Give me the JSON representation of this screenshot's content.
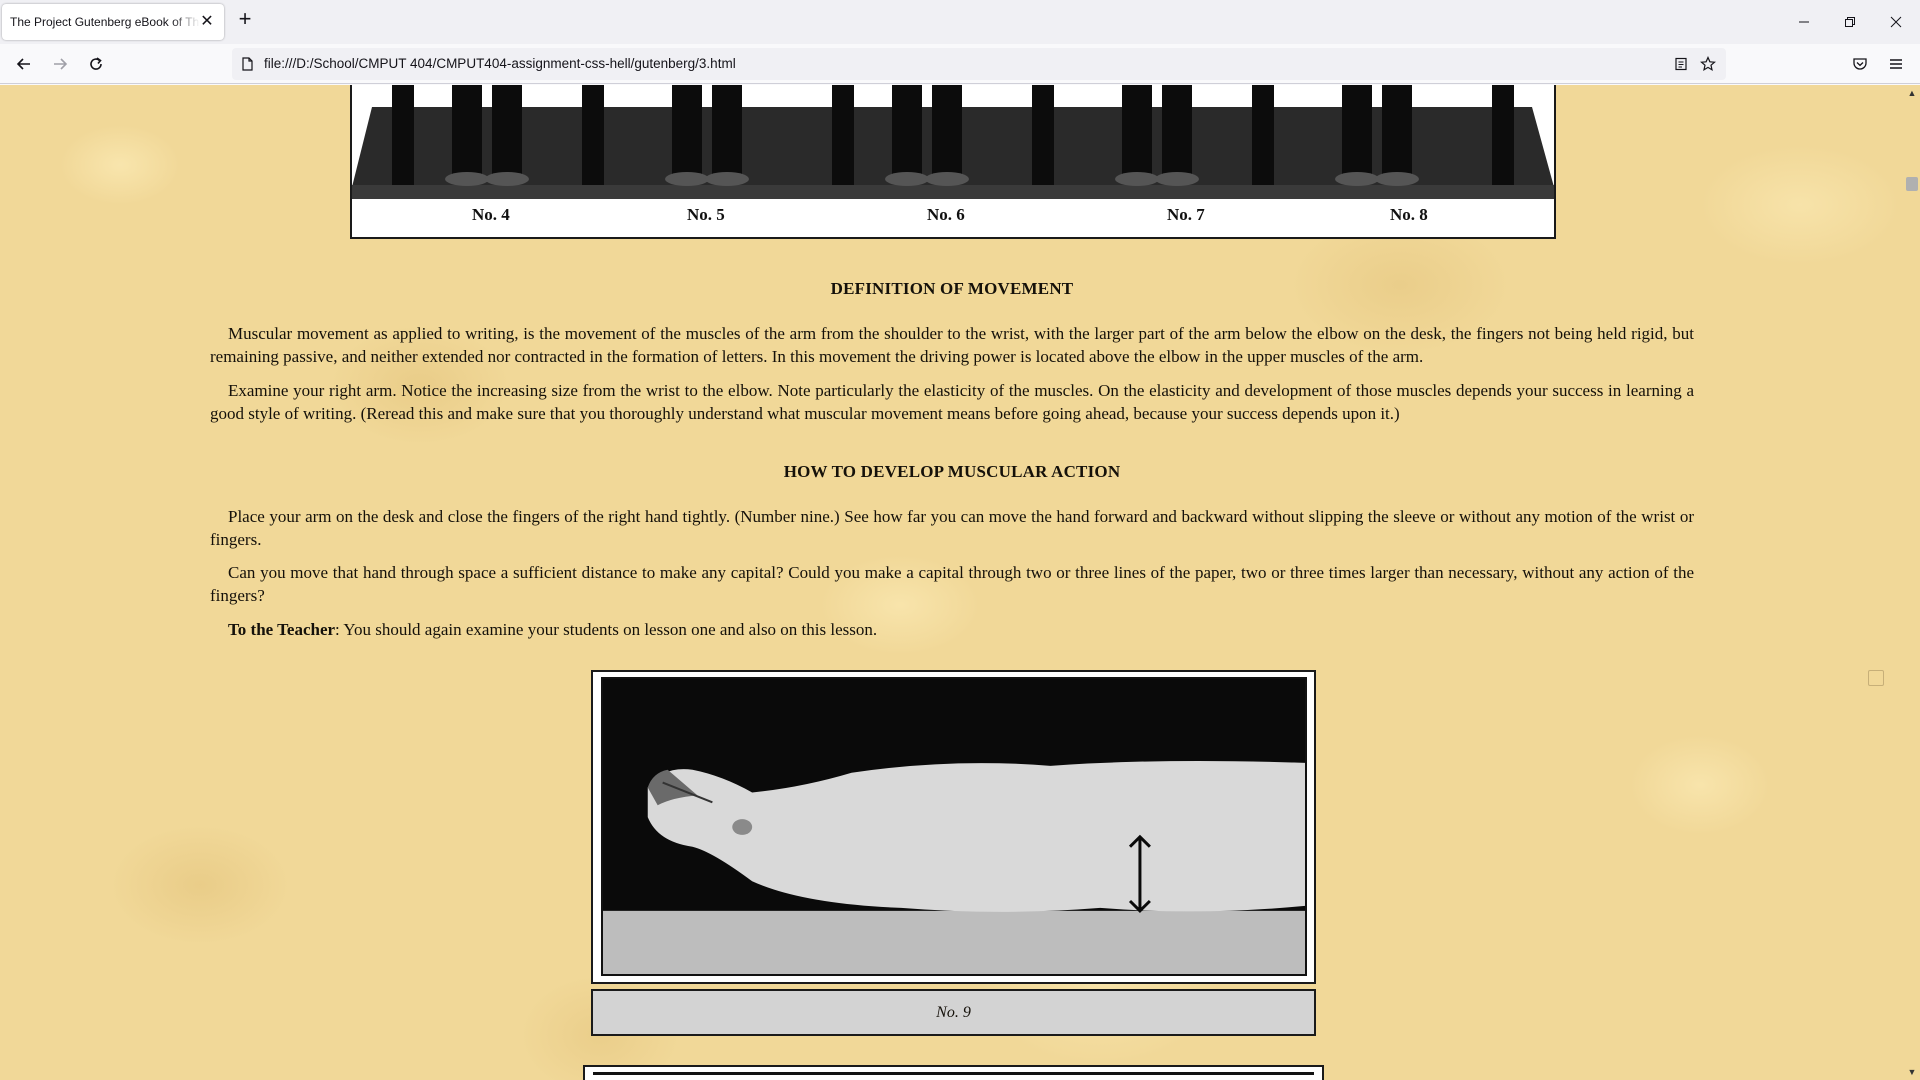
{
  "browser": {
    "tab_title": "The Project Gutenberg eBook of The Palmer Method of Business Writing",
    "url": "file:///D:/School/CMPUT 404/CMPUT404-assignment-css-hell/gutenberg/3.html"
  },
  "page": {
    "desk_labels": [
      "No. 4",
      "No. 5",
      "No. 6",
      "No. 7",
      "No. 8"
    ],
    "section1_title": "DEFINITION OF MOVEMENT",
    "section1_para1": "Muscular movement as applied to writing, is the movement of the muscles of the arm from the shoulder to the wrist, with the larger part of the arm below the elbow on the desk, the fingers not being held rigid, but remaining passive, and neither extended nor contracted in the formation of letters. In this movement the driving power is located above the elbow in the upper muscles of the arm.",
    "section1_para2": "Examine your right arm. Notice the increasing size from the wrist to the elbow. Note particularly the elasticity of the muscles. On the elasticity and development of those muscles depends your success in learning a good style of writing. (Reread this and make sure that you thoroughly understand what muscular movement means before going ahead, because your success depends upon it.)",
    "section2_title": "HOW TO DEVELOP MUSCULAR ACTION",
    "section2_para1": "Place your arm on the desk and close the fingers of the right hand tightly. (Number nine.) See how far you can move the hand forward and backward without slipping the sleeve or without any motion of the wrist or fingers.",
    "section2_para2": "Can you move that hand through space a sufficient distance to make any capital? Could you make a capital through two or three lines of the paper, two or three times larger than necessary, without any action of the fingers?",
    "teacher_label": "To the Teacher",
    "teacher_text": ": You should again examine your students on lesson one and also on this lesson.",
    "figure_caption": "No. 9"
  },
  "icons": {
    "back": "back-arrow-icon",
    "forward": "forward-arrow-icon",
    "reload": "reload-icon",
    "page": "page-icon",
    "reader": "reader-view-icon",
    "bookmark": "star-icon",
    "pocket": "pocket-icon",
    "menu": "hamburger-menu-icon"
  }
}
